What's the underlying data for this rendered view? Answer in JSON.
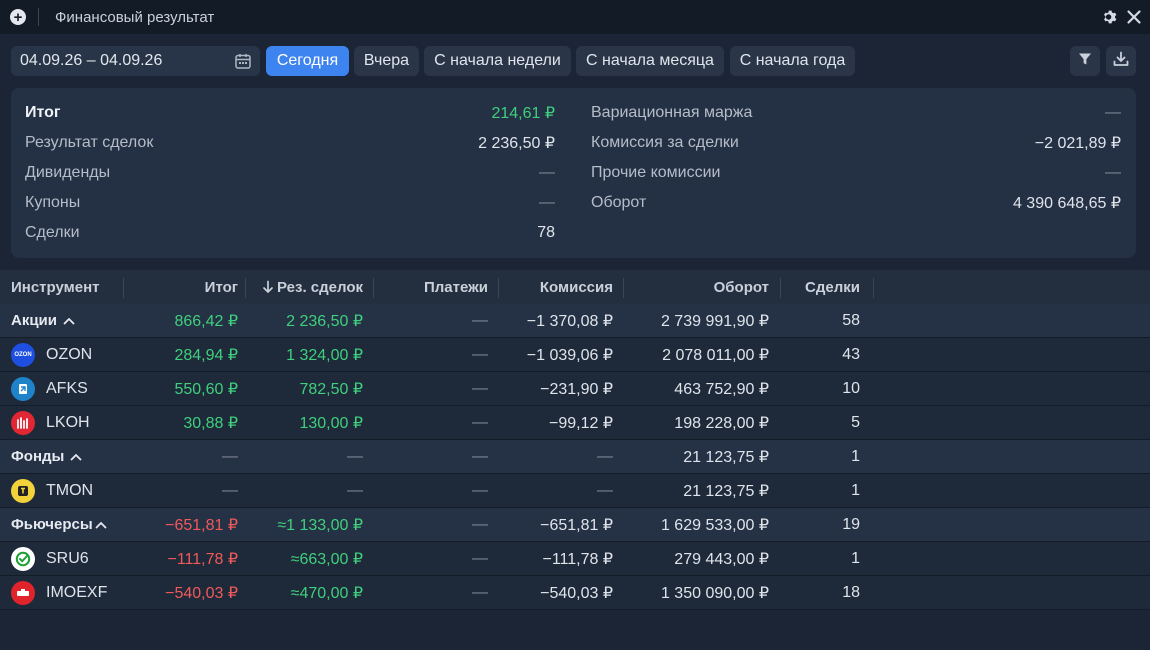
{
  "window": {
    "title": "Финансовый результат"
  },
  "toolbar": {
    "date_range": "04.09.26 – 04.09.26",
    "periods": [
      "Сегодня",
      "Вчера",
      "С начала недели",
      "С начала месяца",
      "С начала года"
    ],
    "active_period": "Сегодня"
  },
  "summary": {
    "left": [
      {
        "label": "Итог",
        "value": "214,61 ₽"
      },
      {
        "label": "Результат сделок",
        "value": "2 236,50 ₽"
      },
      {
        "label": "Дивиденды",
        "value": "—"
      },
      {
        "label": "Купоны",
        "value": "—"
      },
      {
        "label": "Сделки",
        "value": "78"
      }
    ],
    "right": [
      {
        "label": "Вариационная маржа",
        "value": "—"
      },
      {
        "label": "Комиссия за сделки",
        "value": "−2 021,89 ₽"
      },
      {
        "label": "Прочие комиссии",
        "value": "—"
      },
      {
        "label": "Оборот",
        "value": "4 390 648,65 ₽"
      }
    ]
  },
  "table": {
    "columns": [
      "Инструмент",
      "Итог",
      "Рез. сделок",
      "Платежи",
      "Комиссия",
      "Оборот",
      "Сделки"
    ],
    "sort_icon": "arrow-down-icon",
    "rows": [
      {
        "type": "group",
        "name": "Акции",
        "total": "866,42 ₽",
        "result": "2 236,50 ₽",
        "payments": "—",
        "commission": "−1 370,08 ₽",
        "turnover": "2 739 991,90 ₽",
        "trades": "58",
        "total_color": "green",
        "result_color": "green"
      },
      {
        "type": "item",
        "name": "OZON",
        "logo": "ozon",
        "logo_text": "OZON",
        "total": "284,94 ₽",
        "result": "1 324,00 ₽",
        "payments": "—",
        "commission": "−1 039,06 ₽",
        "turnover": "2 078 011,00 ₽",
        "trades": "43",
        "total_color": "green",
        "result_color": "green"
      },
      {
        "type": "item",
        "name": "AFKS",
        "logo": "afks",
        "logo_text": "",
        "total": "550,60 ₽",
        "result": "782,50 ₽",
        "payments": "—",
        "commission": "−231,90 ₽",
        "turnover": "463 752,90 ₽",
        "trades": "10",
        "total_color": "green",
        "result_color": "green"
      },
      {
        "type": "item",
        "name": "LKOH",
        "logo": "lkoh",
        "logo_text": "",
        "total": "30,88 ₽",
        "result": "130,00 ₽",
        "payments": "—",
        "commission": "−99,12 ₽",
        "turnover": "198 228,00 ₽",
        "trades": "5",
        "total_color": "green",
        "result_color": "green"
      },
      {
        "type": "group",
        "name": "Фонды",
        "total": "—",
        "result": "—",
        "payments": "—",
        "commission": "—",
        "turnover": "21 123,75 ₽",
        "trades": "1",
        "total_color": "dash",
        "result_color": "dash"
      },
      {
        "type": "item",
        "name": "TMON",
        "logo": "tmon",
        "logo_text": "",
        "total": "—",
        "result": "—",
        "payments": "—",
        "commission": "—",
        "turnover": "21 123,75 ₽",
        "trades": "1",
        "total_color": "dash",
        "result_color": "dash"
      },
      {
        "type": "group",
        "name": "Фьючерсы",
        "total": "−651,81 ₽",
        "result": "≈1 133,00 ₽",
        "payments": "—",
        "commission": "−651,81 ₽",
        "turnover": "1 629 533,00 ₽",
        "trades": "19",
        "total_color": "red",
        "result_color": "green"
      },
      {
        "type": "item",
        "name": "SRU6",
        "logo": "sru6",
        "logo_text": "",
        "total": "−111,78 ₽",
        "result": "≈663,00 ₽",
        "payments": "—",
        "commission": "−111,78 ₽",
        "turnover": "279 443,00 ₽",
        "trades": "1",
        "total_color": "red",
        "result_color": "green"
      },
      {
        "type": "item",
        "name": "IMOEXF",
        "logo": "imoex",
        "logo_text": "",
        "total": "−540,03 ₽",
        "result": "≈470,00 ₽",
        "payments": "—",
        "commission": "−540,03 ₽",
        "turnover": "1 350 090,00 ₽",
        "trades": "18",
        "total_color": "red",
        "result_color": "green"
      }
    ]
  },
  "colors": {
    "background": "#1b2535",
    "accent": "#3d84f0",
    "positive": "#3fd07d",
    "negative": "#f05a5a"
  }
}
